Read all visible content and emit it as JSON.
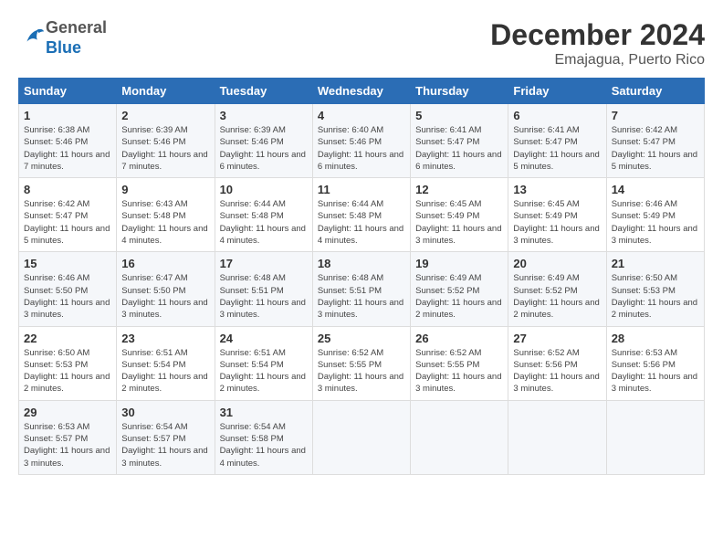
{
  "header": {
    "logo_general": "General",
    "logo_blue": "Blue",
    "month_title": "December 2024",
    "location": "Emajagua, Puerto Rico"
  },
  "weekdays": [
    "Sunday",
    "Monday",
    "Tuesday",
    "Wednesday",
    "Thursday",
    "Friday",
    "Saturday"
  ],
  "weeks": [
    [
      {
        "day": "1",
        "sunrise": "6:38 AM",
        "sunset": "5:46 PM",
        "daylight": "11 hours and 7 minutes."
      },
      {
        "day": "2",
        "sunrise": "6:39 AM",
        "sunset": "5:46 PM",
        "daylight": "11 hours and 7 minutes."
      },
      {
        "day": "3",
        "sunrise": "6:39 AM",
        "sunset": "5:46 PM",
        "daylight": "11 hours and 6 minutes."
      },
      {
        "day": "4",
        "sunrise": "6:40 AM",
        "sunset": "5:46 PM",
        "daylight": "11 hours and 6 minutes."
      },
      {
        "day": "5",
        "sunrise": "6:41 AM",
        "sunset": "5:47 PM",
        "daylight": "11 hours and 6 minutes."
      },
      {
        "day": "6",
        "sunrise": "6:41 AM",
        "sunset": "5:47 PM",
        "daylight": "11 hours and 5 minutes."
      },
      {
        "day": "7",
        "sunrise": "6:42 AM",
        "sunset": "5:47 PM",
        "daylight": "11 hours and 5 minutes."
      }
    ],
    [
      {
        "day": "8",
        "sunrise": "6:42 AM",
        "sunset": "5:47 PM",
        "daylight": "11 hours and 5 minutes."
      },
      {
        "day": "9",
        "sunrise": "6:43 AM",
        "sunset": "5:48 PM",
        "daylight": "11 hours and 4 minutes."
      },
      {
        "day": "10",
        "sunrise": "6:44 AM",
        "sunset": "5:48 PM",
        "daylight": "11 hours and 4 minutes."
      },
      {
        "day": "11",
        "sunrise": "6:44 AM",
        "sunset": "5:48 PM",
        "daylight": "11 hours and 4 minutes."
      },
      {
        "day": "12",
        "sunrise": "6:45 AM",
        "sunset": "5:49 PM",
        "daylight": "11 hours and 3 minutes."
      },
      {
        "day": "13",
        "sunrise": "6:45 AM",
        "sunset": "5:49 PM",
        "daylight": "11 hours and 3 minutes."
      },
      {
        "day": "14",
        "sunrise": "6:46 AM",
        "sunset": "5:49 PM",
        "daylight": "11 hours and 3 minutes."
      }
    ],
    [
      {
        "day": "15",
        "sunrise": "6:46 AM",
        "sunset": "5:50 PM",
        "daylight": "11 hours and 3 minutes."
      },
      {
        "day": "16",
        "sunrise": "6:47 AM",
        "sunset": "5:50 PM",
        "daylight": "11 hours and 3 minutes."
      },
      {
        "day": "17",
        "sunrise": "6:48 AM",
        "sunset": "5:51 PM",
        "daylight": "11 hours and 3 minutes."
      },
      {
        "day": "18",
        "sunrise": "6:48 AM",
        "sunset": "5:51 PM",
        "daylight": "11 hours and 3 minutes."
      },
      {
        "day": "19",
        "sunrise": "6:49 AM",
        "sunset": "5:52 PM",
        "daylight": "11 hours and 2 minutes."
      },
      {
        "day": "20",
        "sunrise": "6:49 AM",
        "sunset": "5:52 PM",
        "daylight": "11 hours and 2 minutes."
      },
      {
        "day": "21",
        "sunrise": "6:50 AM",
        "sunset": "5:53 PM",
        "daylight": "11 hours and 2 minutes."
      }
    ],
    [
      {
        "day": "22",
        "sunrise": "6:50 AM",
        "sunset": "5:53 PM",
        "daylight": "11 hours and 2 minutes."
      },
      {
        "day": "23",
        "sunrise": "6:51 AM",
        "sunset": "5:54 PM",
        "daylight": "11 hours and 2 minutes."
      },
      {
        "day": "24",
        "sunrise": "6:51 AM",
        "sunset": "5:54 PM",
        "daylight": "11 hours and 2 minutes."
      },
      {
        "day": "25",
        "sunrise": "6:52 AM",
        "sunset": "5:55 PM",
        "daylight": "11 hours and 3 minutes."
      },
      {
        "day": "26",
        "sunrise": "6:52 AM",
        "sunset": "5:55 PM",
        "daylight": "11 hours and 3 minutes."
      },
      {
        "day": "27",
        "sunrise": "6:52 AM",
        "sunset": "5:56 PM",
        "daylight": "11 hours and 3 minutes."
      },
      {
        "day": "28",
        "sunrise": "6:53 AM",
        "sunset": "5:56 PM",
        "daylight": "11 hours and 3 minutes."
      }
    ],
    [
      {
        "day": "29",
        "sunrise": "6:53 AM",
        "sunset": "5:57 PM",
        "daylight": "11 hours and 3 minutes."
      },
      {
        "day": "30",
        "sunrise": "6:54 AM",
        "sunset": "5:57 PM",
        "daylight": "11 hours and 3 minutes."
      },
      {
        "day": "31",
        "sunrise": "6:54 AM",
        "sunset": "5:58 PM",
        "daylight": "11 hours and 4 minutes."
      },
      null,
      null,
      null,
      null
    ]
  ],
  "labels": {
    "sunrise": "Sunrise:",
    "sunset": "Sunset:",
    "daylight": "Daylight:"
  }
}
